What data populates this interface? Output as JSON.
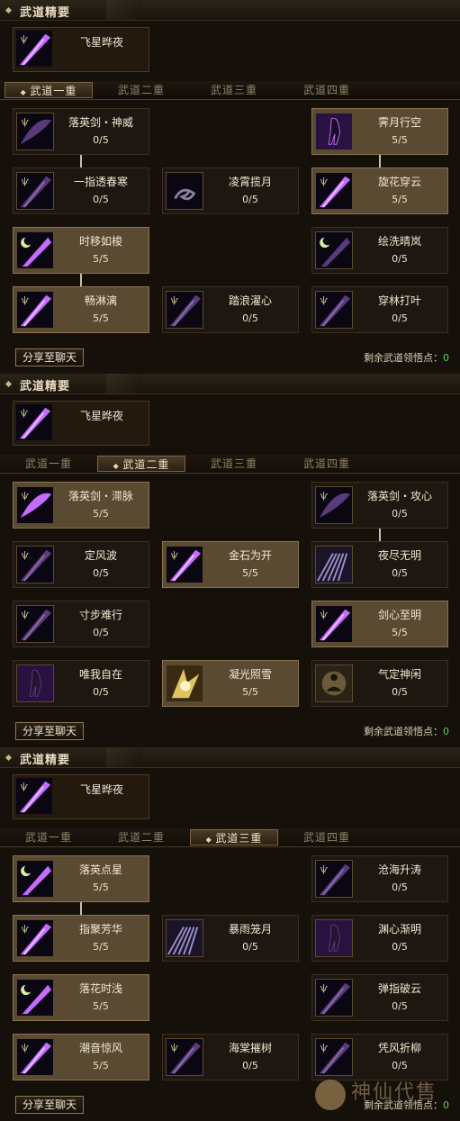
{
  "panels": [
    {
      "header": "武道精要",
      "essence": "飞星晔夜",
      "tabs": [
        "武道一重",
        "武道二重",
        "武道三重",
        "武道四重"
      ],
      "active_tab": 0,
      "skills": [
        {
          "name": "落英剑・神威",
          "points": "0/5",
          "active": false,
          "icon": "crescent-blade-icon"
        },
        {
          "name": "霁月行空",
          "points": "5/5",
          "active": true,
          "icon": "shadow-figure-icon"
        },
        {
          "name": "一指透春寒",
          "points": "0/5",
          "active": false,
          "icon": "blade-slash-icon"
        },
        {
          "name": "凌霄揽月",
          "points": "0/5",
          "active": false,
          "icon": "swirl-icon"
        },
        {
          "name": "旋花穿云",
          "points": "5/5",
          "active": true,
          "icon": "blade-slash-icon"
        },
        {
          "name": "时移如梭",
          "points": "5/5",
          "active": true,
          "icon": "moon-blade-icon"
        },
        {
          "name": "绘洗晴岚",
          "points": "0/5",
          "active": false,
          "icon": "moon-blade-icon"
        },
        {
          "name": "畅淋漓",
          "points": "5/5",
          "active": true,
          "icon": "blade-slash-icon"
        },
        {
          "name": "踏浪濯心",
          "points": "0/5",
          "active": false,
          "icon": "blade-slash-icon"
        },
        {
          "name": "穿林打叶",
          "points": "0/5",
          "active": false,
          "icon": "blade-slash-icon"
        }
      ],
      "share_label": "分享至聊天",
      "remaining_label": "剩余武道领悟点：",
      "remaining_value": "0"
    },
    {
      "header": "武道精要",
      "essence": "飞星晔夜",
      "tabs": [
        "武道一重",
        "武道二重",
        "武道三重",
        "武道四重"
      ],
      "active_tab": 1,
      "skills": [
        {
          "name": "落英剑・滞脉",
          "points": "5/5",
          "active": true,
          "icon": "crescent-blade-icon"
        },
        {
          "name": "落英剑・攻心",
          "points": "0/5",
          "active": false,
          "icon": "crescent-blade-icon"
        },
        {
          "name": "定风波",
          "points": "0/5",
          "active": false,
          "icon": "blade-slash-icon"
        },
        {
          "name": "金石为开",
          "points": "5/5",
          "active": true,
          "icon": "blade-slash-icon"
        },
        {
          "name": "夜尽无明",
          "points": "0/5",
          "active": false,
          "icon": "light-rays-icon"
        },
        {
          "name": "寸步难行",
          "points": "0/5",
          "active": false,
          "icon": "blade-slash-icon"
        },
        {
          "name": "剑心至明",
          "points": "5/5",
          "active": true,
          "icon": "blade-slash-icon"
        },
        {
          "name": "唯我自在",
          "points": "0/5",
          "active": false,
          "icon": "shadow-figure-icon"
        },
        {
          "name": "凝光照雪",
          "points": "5/5",
          "active": true,
          "icon": "golden-burst-icon"
        },
        {
          "name": "气定神闲",
          "points": "0/5",
          "active": false,
          "icon": "meditation-icon"
        }
      ],
      "share_label": "分享至聊天",
      "remaining_label": "剩余武道领悟点：",
      "remaining_value": "0"
    },
    {
      "header": "武道精要",
      "essence": "飞星晔夜",
      "tabs": [
        "武道一重",
        "武道二重",
        "武道三重",
        "武道四重"
      ],
      "active_tab": 2,
      "skills": [
        {
          "name": "落英点星",
          "points": "5/5",
          "active": true,
          "icon": "moon-blade-icon"
        },
        {
          "name": "沧海升涛",
          "points": "0/5",
          "active": false,
          "icon": "blade-slash-icon"
        },
        {
          "name": "指聚芳华",
          "points": "5/5",
          "active": true,
          "icon": "blade-slash-icon"
        },
        {
          "name": "暴雨笼月",
          "points": "0/5",
          "active": false,
          "icon": "light-rays-icon"
        },
        {
          "name": "渊心渐明",
          "points": "0/5",
          "active": false,
          "icon": "shadow-figure-icon"
        },
        {
          "name": "落花时浅",
          "points": "5/5",
          "active": true,
          "icon": "moon-blade-icon"
        },
        {
          "name": "弹指破云",
          "points": "0/5",
          "active": false,
          "icon": "blade-slash-icon"
        },
        {
          "name": "潮音惊风",
          "points": "5/5",
          "active": true,
          "icon": "blade-slash-icon"
        },
        {
          "name": "海棠摧树",
          "points": "0/5",
          "active": false,
          "icon": "blade-slash-icon"
        },
        {
          "name": "凭风折柳",
          "points": "0/5",
          "active": false,
          "icon": "blade-slash-icon"
        }
      ],
      "share_label": "分享至聊天",
      "remaining_label": "剩余武道领悟点：",
      "remaining_value": "0"
    }
  ],
  "watermark": "神仙代售",
  "colors": {
    "active_cell": "#5a4a31",
    "inactive_cell": "#1e1610",
    "remaining_value": "#5fd14a",
    "icon_purple": "#8b3fd8"
  }
}
